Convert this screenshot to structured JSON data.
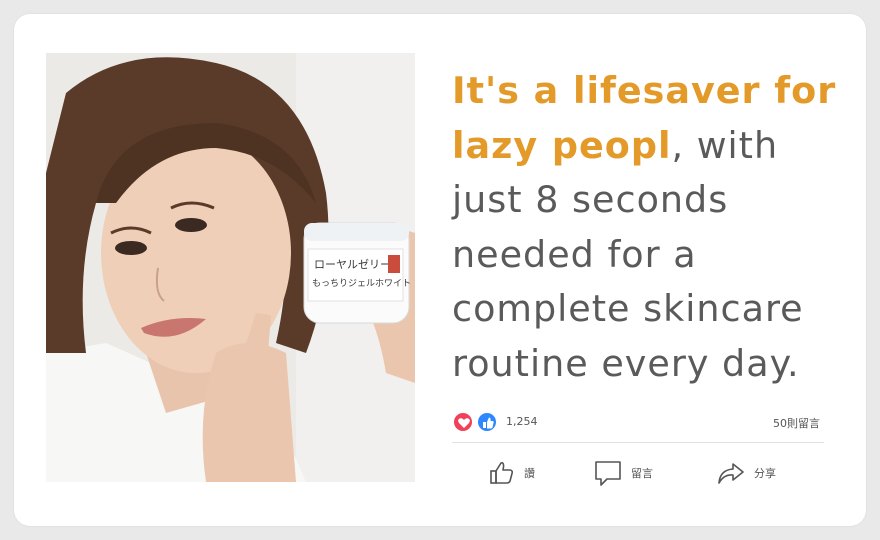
{
  "post": {
    "quote_highlight": "It's a lifesaver for lazy peopl",
    "quote_rest": ", with just 8 seconds needed for a complete skincare routine every day.",
    "accent_color": "#e39a28",
    "text_color": "#5a5a5a"
  },
  "photo": {
    "jar_label_line1": "ローヤルゼリー",
    "jar_label_line2": "もっちりジェルホワイト"
  },
  "reactions": {
    "count": "1,254",
    "comments": "50則留言",
    "icons": [
      "heart-icon",
      "like-icon"
    ]
  },
  "actions": {
    "like_label": "讚",
    "comment_label": "留言",
    "share_label": "分享"
  }
}
